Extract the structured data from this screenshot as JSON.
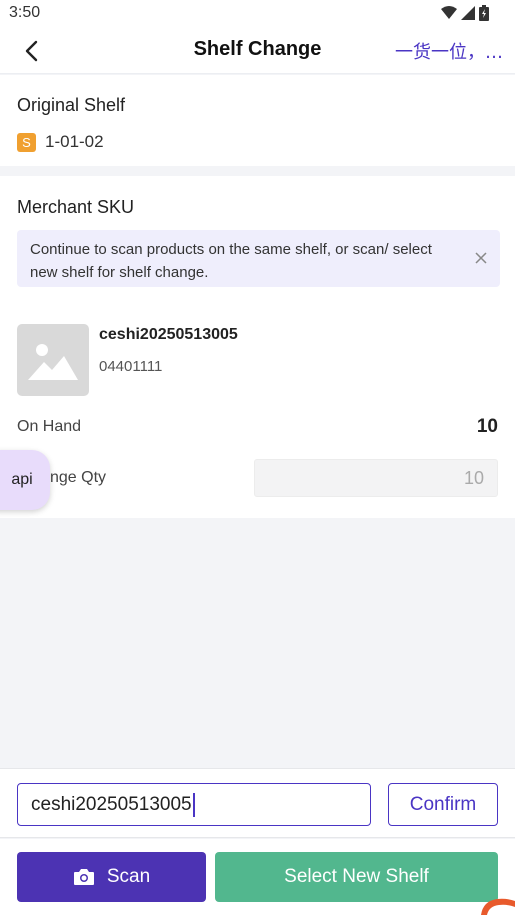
{
  "status": {
    "time": "3:50"
  },
  "nav": {
    "title": "Shelf Change",
    "right_text": "一货一位，…"
  },
  "original_shelf": {
    "title": "Original Shelf",
    "badge": "S",
    "code": "1-01-02"
  },
  "merchant_sku": {
    "title": "Merchant SKU",
    "notice": "Continue to scan products on the same shelf, or scan/ select new shelf for shelf change."
  },
  "product": {
    "name": "ceshi20250513005",
    "code": "04401111",
    "on_hand_label": "On Hand",
    "on_hand_value": "10",
    "change_qty_label": "nge Qty",
    "change_qty_value": "10"
  },
  "api_bubble": "api",
  "scan_input": {
    "value": "ceshi20250513005"
  },
  "buttons": {
    "confirm": "Confirm",
    "scan": "Scan",
    "select_new_shelf": "Select New Shelf"
  },
  "colors": {
    "primary": "#4c33b3",
    "accent_green": "#52b78e",
    "badge_orange": "#f0a030",
    "notice_bg": "#efeefc"
  }
}
